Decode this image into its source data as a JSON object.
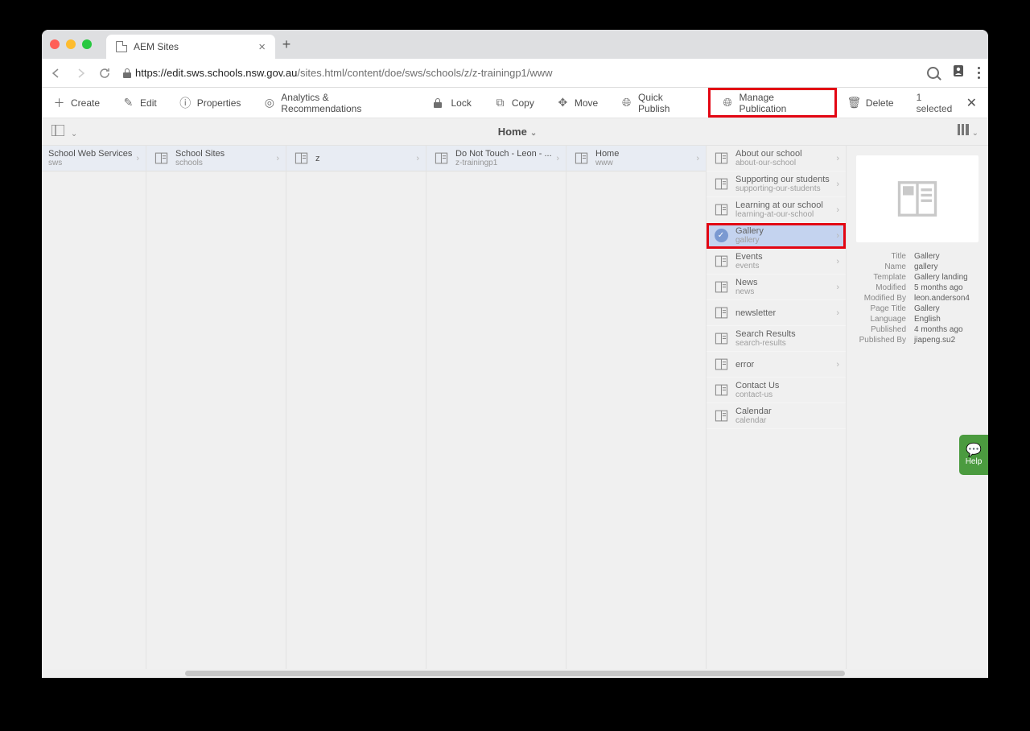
{
  "tab": {
    "title": "AEM Sites"
  },
  "url": {
    "host": "https://edit.sws.schools.nsw.gov.au",
    "path": "/sites.html/content/doe/sws/schools/z/z-trainingp1/www"
  },
  "actions": {
    "create": "Create",
    "edit": "Edit",
    "properties": "Properties",
    "analytics": "Analytics & Recommendations",
    "lock": "Lock",
    "copy": "Copy",
    "move": "Move",
    "quickpublish": "Quick Publish",
    "managepub": "Manage Publication",
    "delete": "Delete",
    "selected": "1 selected"
  },
  "header": {
    "title": "Home"
  },
  "columns": [
    {
      "title": "School Web Services",
      "sub": "sws"
    },
    {
      "title": "School Sites",
      "sub": "schools"
    },
    {
      "title": "z",
      "sub": ""
    },
    {
      "title": "Do Not Touch - Leon - ...",
      "sub": "z-trainingp1"
    },
    {
      "title": "Home",
      "sub": "www"
    }
  ],
  "pages": [
    {
      "title": "About our school",
      "sub": "about-our-school",
      "arrow": true
    },
    {
      "title": "Supporting our students",
      "sub": "supporting-our-students",
      "arrow": true
    },
    {
      "title": "Learning at our school",
      "sub": "learning-at-our-school",
      "arrow": true
    },
    {
      "title": "Gallery",
      "sub": "gallery",
      "arrow": true,
      "selected": true,
      "highlight": true
    },
    {
      "title": "Events",
      "sub": "events",
      "arrow": true
    },
    {
      "title": "News",
      "sub": "news",
      "arrow": true
    },
    {
      "title": "newsletter",
      "sub": "",
      "arrow": true
    },
    {
      "title": "Search Results",
      "sub": "search-results",
      "arrow": false
    },
    {
      "title": "error",
      "sub": "",
      "arrow": true
    },
    {
      "title": "Contact Us",
      "sub": "contact-us",
      "arrow": false
    },
    {
      "title": "Calendar",
      "sub": "calendar",
      "arrow": false
    }
  ],
  "details": {
    "Title": "Gallery",
    "Name": "gallery",
    "Template": "Gallery landing",
    "Modified": "5 months ago",
    "Modified By": "leon.anderson4",
    "Page Title": "Gallery",
    "Language": "English",
    "Published": "4 months ago",
    "Published By": "jiapeng.su2"
  },
  "help": {
    "label": "Help"
  }
}
